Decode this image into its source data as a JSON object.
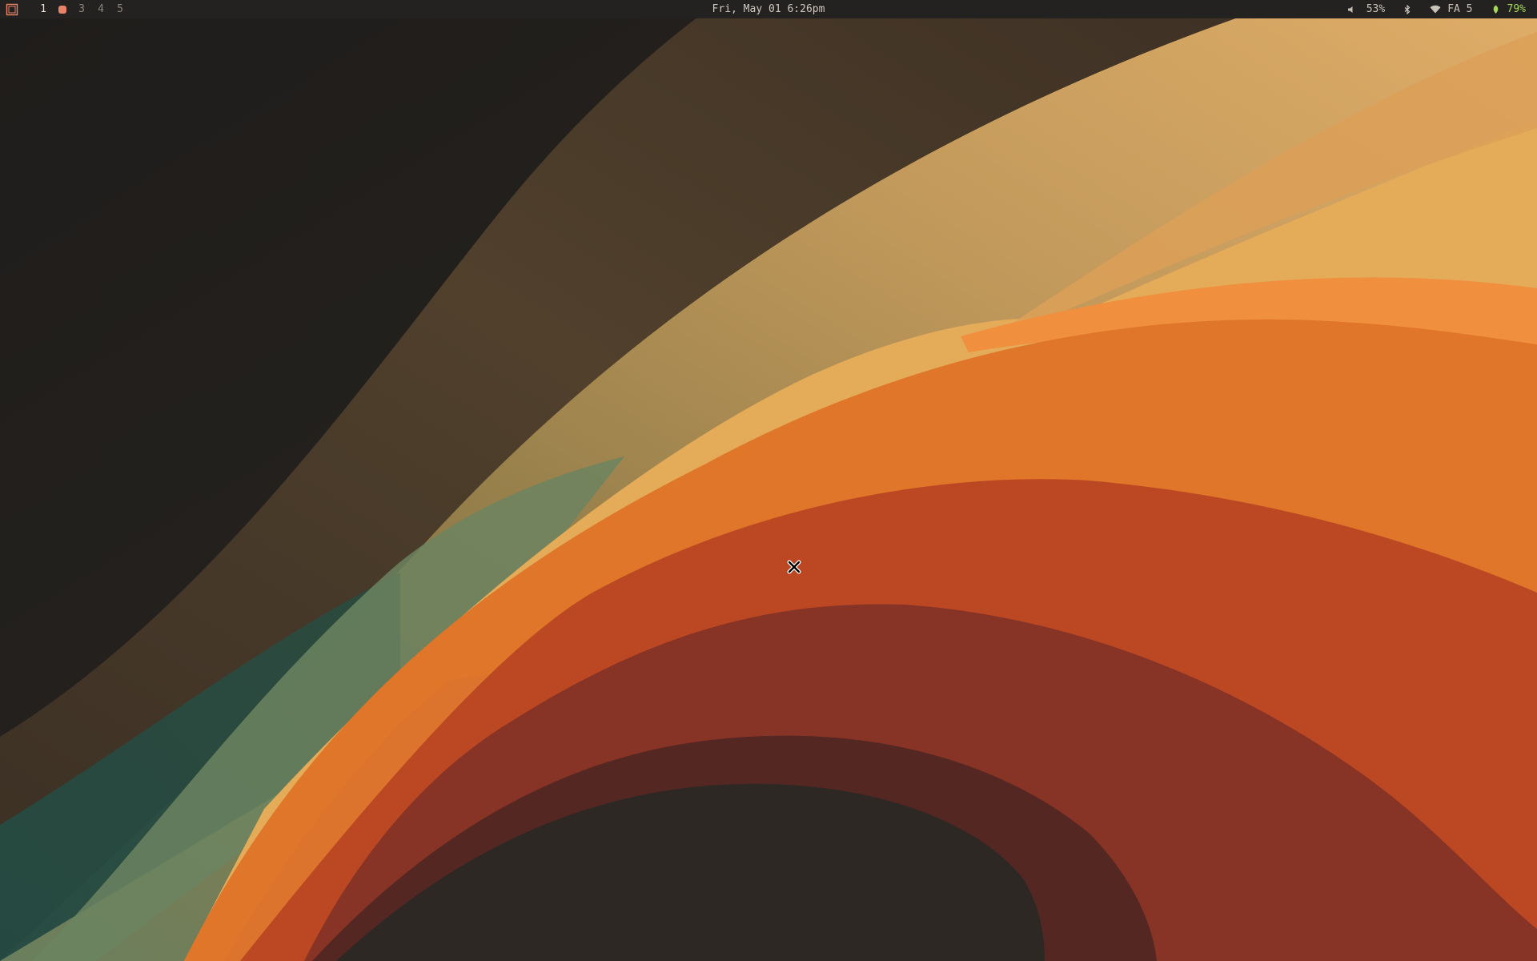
{
  "topbar": {
    "launcher_icon": "app-launcher-icon",
    "workspaces": {
      "ws1": "1",
      "ws2_indicator": "occupied-workspace-dot",
      "ws3": "3",
      "ws4": "4",
      "ws5": "5"
    },
    "clock": "Fri, May 01 6:26pm",
    "volume": {
      "icon": "speaker-icon",
      "value": "53%"
    },
    "bluetooth": {
      "icon": "bluetooth-icon"
    },
    "wifi": {
      "icon": "wifi-icon",
      "value": "FA 5"
    },
    "battery": {
      "icon": "battery-leaf-icon",
      "value": "79%"
    }
  },
  "desktop": {
    "wallpaper": "abstract-orange-waves",
    "cursor_icon": "x-cursor-icon"
  },
  "colors": {
    "bar_bg": "#242220",
    "workspace_accent": "#e8836a",
    "battery_green": "#a6d85a",
    "wave_gold": "#e4ab58",
    "wave_orange": "#df7629",
    "wave_red": "#bb4823",
    "wave_teal": "#264640"
  }
}
